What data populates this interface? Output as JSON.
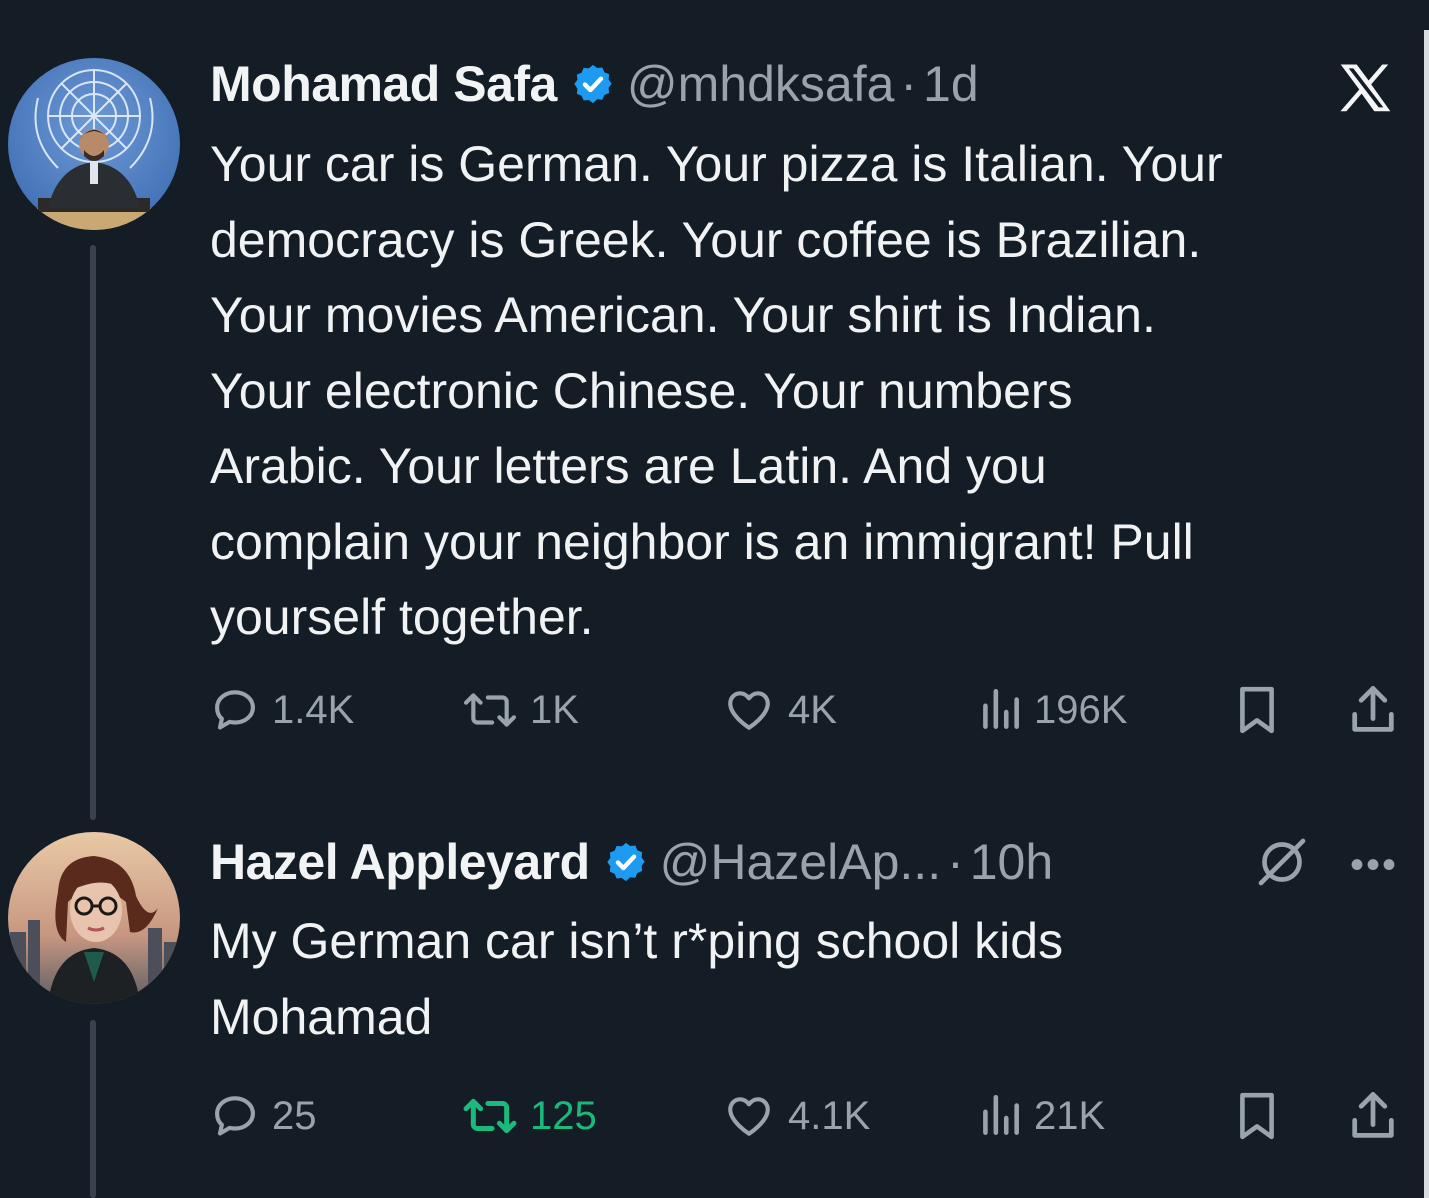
{
  "tweets": [
    {
      "name": "Mohamad Safa",
      "handle": "@mhdksafa",
      "separator": "·",
      "time": "1d",
      "lines": [
        "Your car is German. Your pizza is Italian. Your",
        "democracy is Greek. Your coffee is Brazilian.",
        "Your movies American. Your shirt is Indian.",
        "Your electronic Chinese. Your numbers",
        "Arabic. Your letters are Latin. And you",
        "complain your neighbor is an immigrant! Pull",
        "yourself together."
      ],
      "stats": {
        "replies": "1.4K",
        "reposts": "1K",
        "likes": "4K",
        "views": "196K"
      },
      "icons": [
        "verified-badge-icon",
        "x-logo-icon",
        "reply-icon",
        "repost-icon",
        "like-icon",
        "views-icon",
        "bookmark-icon",
        "share-icon"
      ]
    },
    {
      "name": "Hazel Appleyard",
      "handle": "@HazelAp...",
      "separator": "·",
      "time": "10h",
      "lines": [
        "My German car isn’t r*ping school kids",
        "Mohamad"
      ],
      "stats": {
        "replies": "25",
        "reposts": "125",
        "likes": "4.1K",
        "views": "21K"
      },
      "icons": [
        "verified-badge-icon",
        "grok-icon",
        "more-icon",
        "reply-icon",
        "repost-icon",
        "like-icon",
        "views-icon",
        "bookmark-icon",
        "share-icon"
      ]
    }
  ],
  "colors": {
    "background": "#141c26",
    "text": "#e7e9ea",
    "muted": "#9aa3ac",
    "verified": "#1d9bf0",
    "repost_active": "#19ba7c"
  }
}
